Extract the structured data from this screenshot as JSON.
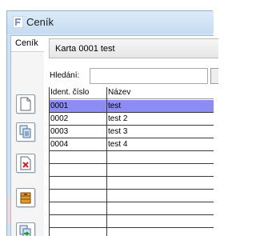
{
  "window": {
    "title": "Ceník"
  },
  "sidebar": {
    "tab_label": "Ceník"
  },
  "toolbar": {
    "buttons": [
      {
        "name": "new-document",
        "icon": "document-icon"
      },
      {
        "name": "copy-document",
        "icon": "copy-documents-icon"
      },
      {
        "name": "delete-document",
        "icon": "delete-document-icon"
      },
      {
        "name": "archive",
        "icon": "archive-icon"
      },
      {
        "name": "export",
        "icon": "export-documents-icon"
      }
    ]
  },
  "card": {
    "tab_label": "Karta 0001 test"
  },
  "search": {
    "label": "Hledání:",
    "value": ""
  },
  "table": {
    "columns": [
      "Ident. číslo",
      "Název"
    ],
    "rows": [
      {
        "id": "0001",
        "name": "test"
      },
      {
        "id": "0002",
        "name": "test 2"
      },
      {
        "id": "0003",
        "name": "test 3"
      },
      {
        "id": "0004",
        "name": "test 4"
      }
    ],
    "selected_row": 0
  },
  "colors": {
    "selection": "#8c8cf2",
    "highlight": "#f6d7d8",
    "frame": "#cfe3f5"
  }
}
